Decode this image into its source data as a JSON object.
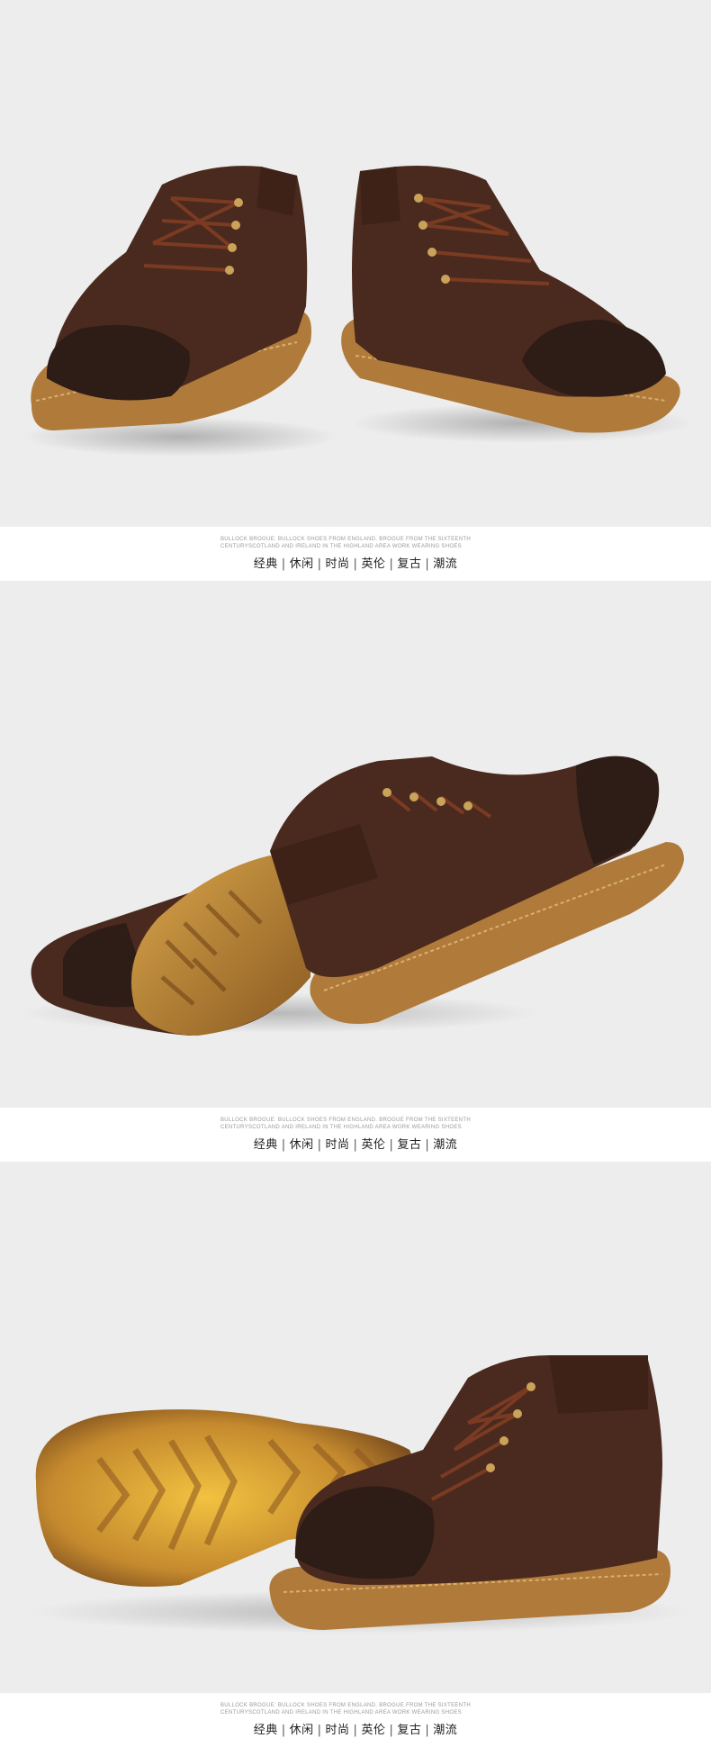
{
  "sections": [
    {
      "caption_en_line1": "BULLOCK BROGUE: BULLOCK SHOES FROM ENGLAND. BROGUE FROM THE SIXTEENTH",
      "caption_en_line2": "CENTURYSCOTLAND AND IRELAND IN THE HIGHLAND AREA WORK WEARING SHOES",
      "tags": [
        "经典",
        "休闲",
        "时尚",
        "英伦",
        "复古",
        "潮流"
      ]
    },
    {
      "caption_en_line1": "BULLOCK BROGUE: BULLOCK SHOES FROM ENGLAND. BROGUE FROM THE SIXTEENTH",
      "caption_en_line2": "CENTURYSCOTLAND AND IRELAND IN THE HIGHLAND AREA WORK WEARING SHOES",
      "tags": [
        "经典",
        "休闲",
        "时尚",
        "英伦",
        "复古",
        "潮流"
      ]
    },
    {
      "caption_en_line1": "BULLOCK BROGUE: BULLOCK SHOES FROM ENGLAND. BROGUE FROM THE SIXTEENTH",
      "caption_en_line2": "CENTURYSCOTLAND AND IRELAND IN THE HIGHLAND AREA WORK WEARING SHOES",
      "tags": [
        "经典",
        "休闲",
        "时尚",
        "英伦",
        "复古",
        "潮流"
      ]
    }
  ],
  "separator": "|",
  "colors": {
    "photo_background": "#ededed",
    "suede": "#4a2a1e",
    "toe_cap": "#2e1c16",
    "sole": "#b07a3a",
    "laces": "#7a3b22",
    "eyelets": "#c9a35a"
  }
}
